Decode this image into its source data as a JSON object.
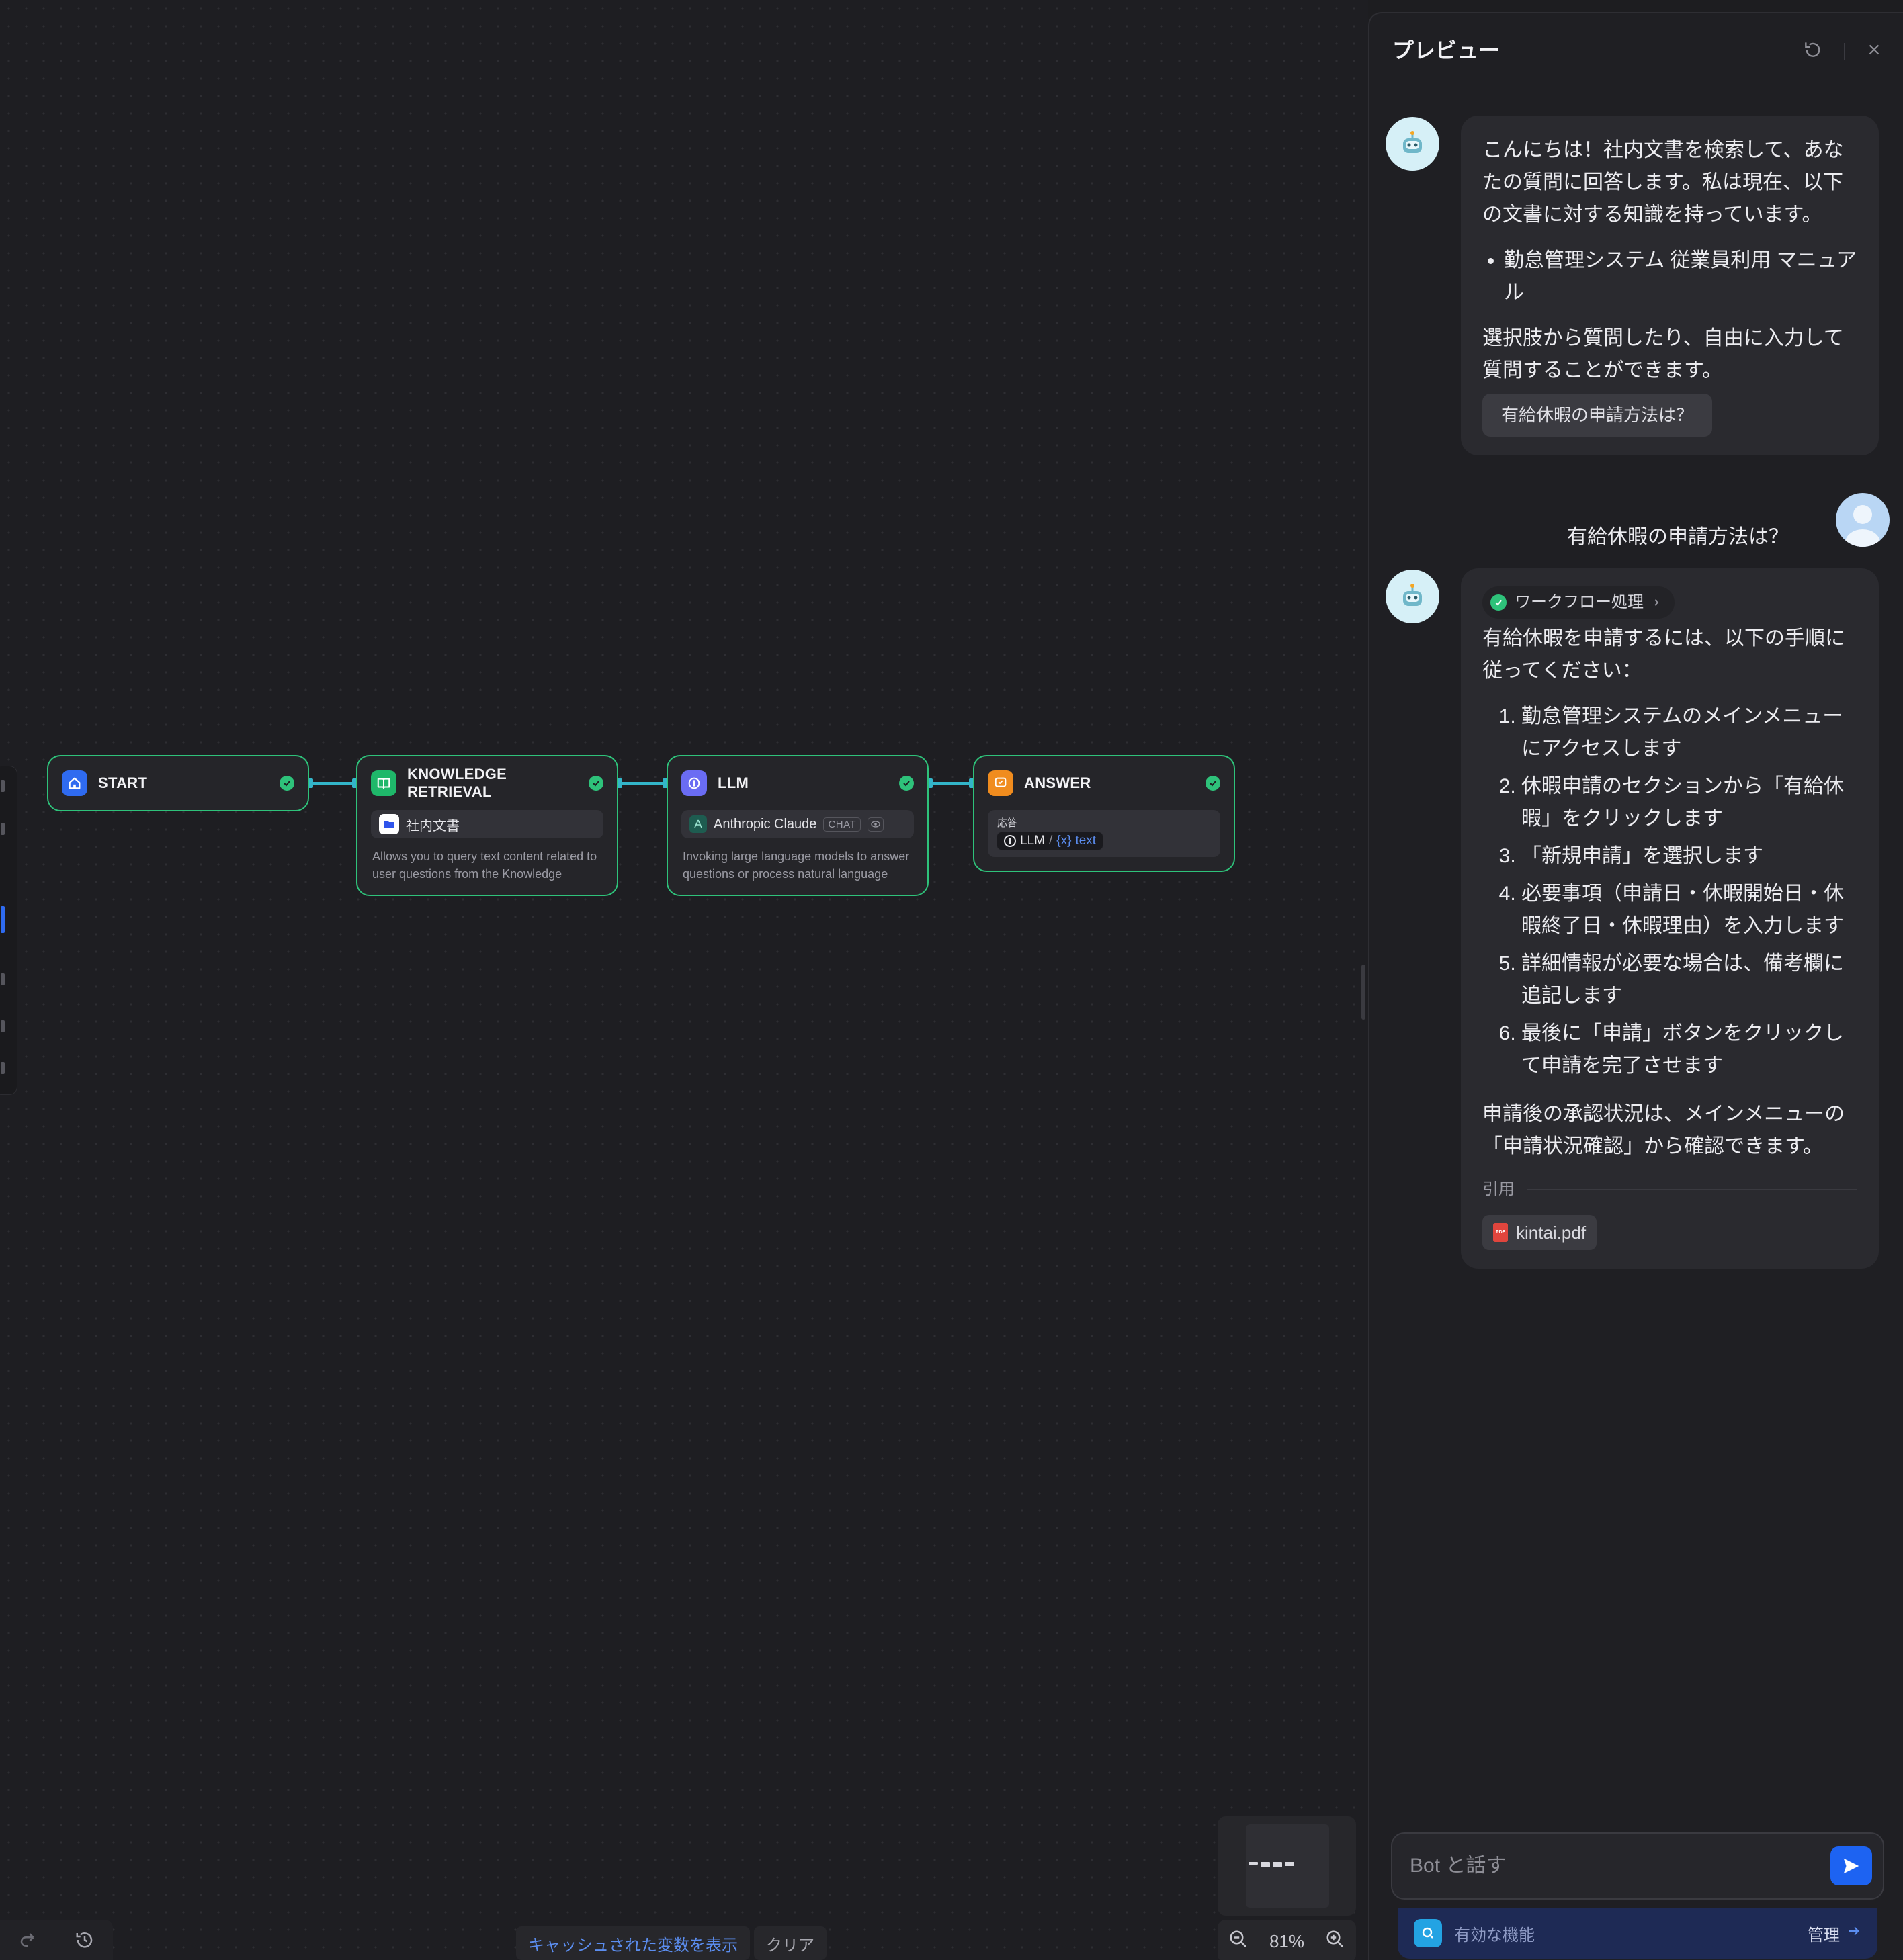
{
  "colors": {
    "accent": "#1d63f2",
    "node_border": "#2ec27a",
    "edge": "#33b5c9",
    "start_icon": "#2f6bf0",
    "knowledge_icon": "#1fb86a",
    "llm_icon": "#6a6cf3",
    "answer_icon": "#f08c1e"
  },
  "workflow": {
    "nodes": [
      {
        "id": "start",
        "title": "START",
        "icon": "home-icon"
      },
      {
        "id": "knowledge",
        "title": "KNOWLEDGE RETRIEVAL",
        "icon": "book-icon",
        "field": "社内文書",
        "desc": "Allows you to query text content related to user questions from the Knowledge"
      },
      {
        "id": "llm",
        "title": "LLM",
        "icon": "llm-icon",
        "model": "Anthropic Claude",
        "mode": "CHAT",
        "desc": "Invoking large language models to answer questions or process natural language"
      },
      {
        "id": "answer",
        "title": "ANSWER",
        "icon": "chat-icon",
        "label": "応答",
        "var_node": "LLM",
        "var_sep": "/",
        "var_prefix": "{x}",
        "var_name": "text"
      }
    ],
    "zoom": "81%",
    "cache_show": "キャッシュされた変数を表示",
    "cache_clear": "クリア"
  },
  "preview": {
    "title": "プレビュー",
    "messages": [
      {
        "role": "bot",
        "intro": "こんにちは！社内文書を検索して、あなたの質問に回答します。私は現在、以下の文書に対する知識を持っています。",
        "docs": [
          "勤怠管理システム 従業員利用 マニュアル"
        ],
        "outro": "選択肢から質問したり、自由に入力して質問することができます。",
        "suggestion": "有給休暇の申請方法は？"
      },
      {
        "role": "user",
        "text": "有給休暇の申請方法は？"
      },
      {
        "role": "bot",
        "workflow_label": "ワークフロー処理",
        "intro": "有給休暇を申請するには、以下の手順に従ってください：",
        "steps": [
          "勤怠管理システムのメインメニューにアクセスします",
          "休暇申請のセクションから「有給休暇」をクリックします",
          "「新規申請」を選択します",
          "必要事項（申請日・休暇開始日・休暇終了日・休暇理由）を入力します",
          "詳細情報が必要な場合は、備考欄に追記します",
          "最後に「申請」ボタンをクリックして申請を完了させます"
        ],
        "outro": "申請後の承認状況は、メインメニューの「申請状況確認」から確認できます。",
        "citation_label": "引用",
        "citation_file": "kintai.pdf",
        "pdf_badge": "PDF"
      }
    ],
    "input_placeholder": "Bot と話す",
    "features_label": "有効な機能",
    "features_manage": "管理"
  }
}
